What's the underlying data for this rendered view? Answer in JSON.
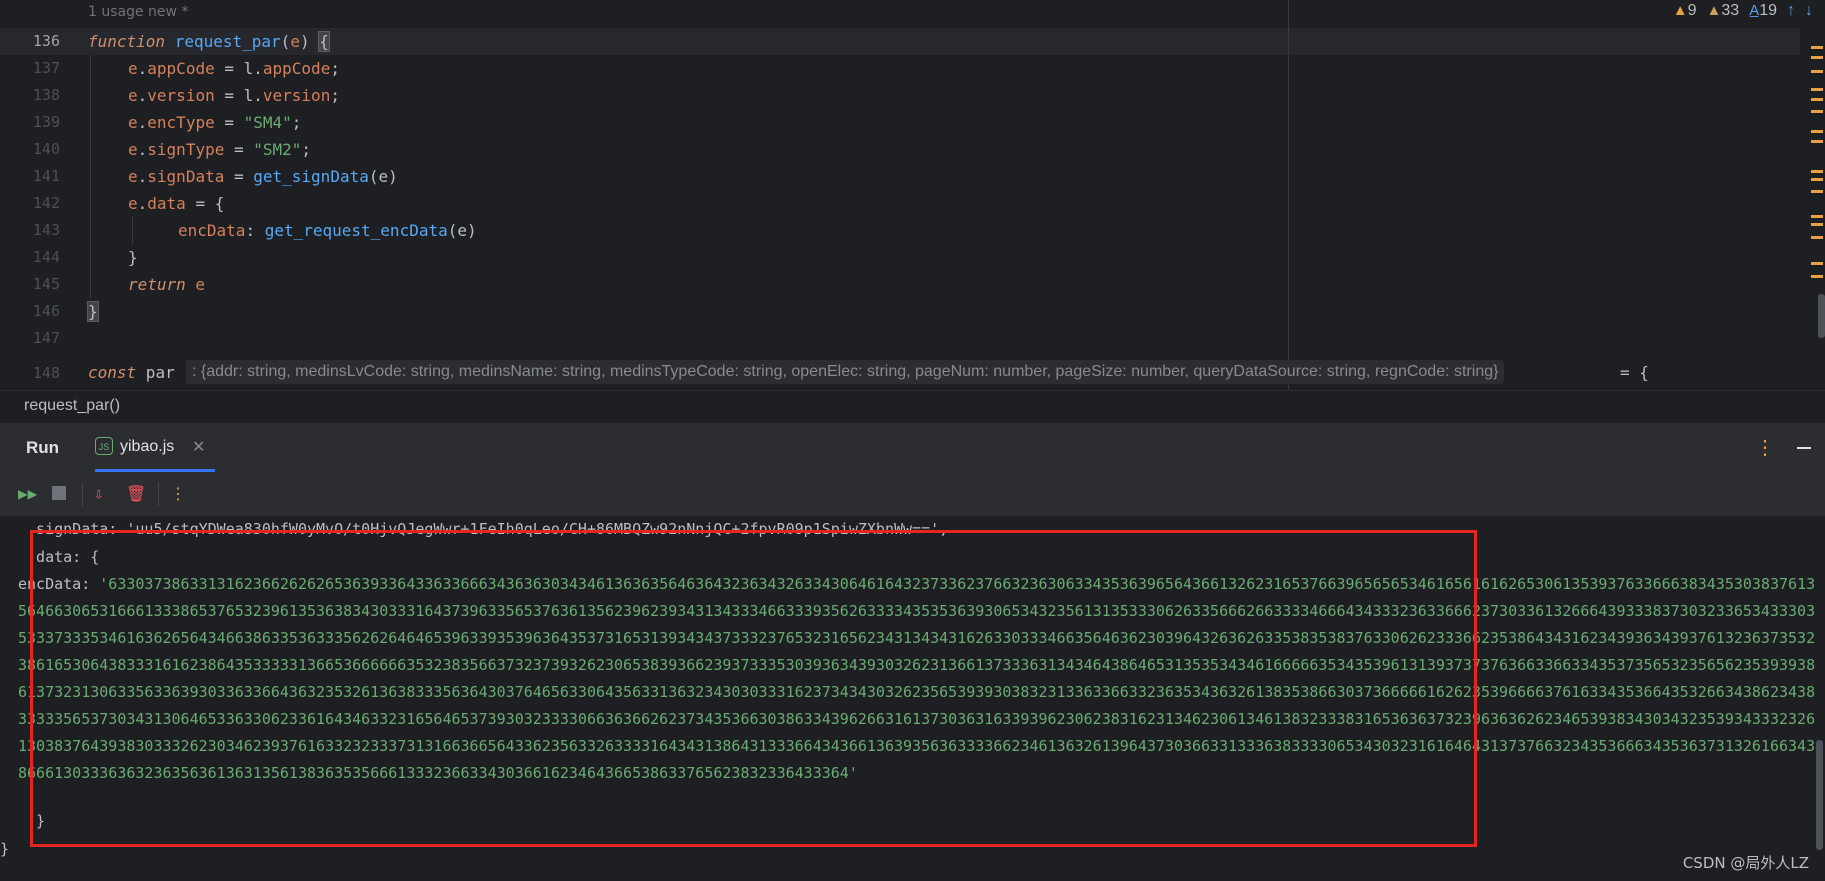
{
  "editor": {
    "usage_hint": "1 usage   new *",
    "line_numbers": [
      "136",
      "137",
      "138",
      "139",
      "140",
      "141",
      "142",
      "143",
      "144",
      "145",
      "146",
      "147",
      "148"
    ],
    "lines": {
      "l136_kw": "function",
      "l136_name": "request_par",
      "l136_open": "(",
      "l136_param": "e",
      "l136_close": ") ",
      "l136_brace": "{",
      "l137_obj": "e",
      "l137_prop": "appCode",
      "l137_eq": " = l.",
      "l137_rhs": "appCode",
      "l137_semi": ";",
      "l138_obj": "e",
      "l138_prop": "version",
      "l138_eq": " = l.",
      "l138_rhs": "version",
      "l138_semi": ";",
      "l139_obj": "e",
      "l139_prop": "encType",
      "l139_eq": " = ",
      "l139_str": "\"SM4\"",
      "l139_semi": ";",
      "l140_obj": "e",
      "l140_prop": "signType",
      "l140_eq": " = ",
      "l140_str": "\"SM2\"",
      "l140_semi": ";",
      "l141_obj": "e",
      "l141_prop": "signData",
      "l141_eq": " = ",
      "l141_fn": "get_signData",
      "l141_arg": "(e)",
      "l142_obj": "e",
      "l142_prop": "data",
      "l142_rest": " = {",
      "l143_key": "encData",
      "l143_colon": ": ",
      "l143_fn": "get_request_encData",
      "l143_arg": "(e)",
      "l144": "}",
      "l145_kw": "return",
      "l145_var": " e",
      "l146": "}",
      "l148_kw": "const",
      "l148_name": " par"
    },
    "inlay_hint": ": {addr: string, medinsLvCode: string, medinsName: string, medinsTypeCode: string, openElec: string, pageNum: number, pageSize: number, queryDataSource: string, regnCode: string}",
    "inlay_after": "= {",
    "inspections": {
      "warnings": "9",
      "weak_warnings": "33",
      "typos": "19"
    }
  },
  "breadcrumb": "request_par()",
  "run_panel": {
    "title": "Run",
    "tab_label": "yibao.js",
    "tab_icon": "JS"
  },
  "console": {
    "sign_line": "  signData: 'uu5/stqYDWea830hfW0yMvO/t0HjvQJegWwr+1FeIh0qLeo/CH+86MBQZw92nNnjQC+2fpvR09p1SpiwZXbnWw==',",
    "data_line": "  data: {",
    "enc_key": "    encData: ",
    "enc_value": "'63303738633131623662626265363933643363366634363630343461363635646364323634326334306461643237336237663236306334353639656436613262316537663965656534616561616265306135393763366638343530383761356466306531666133386537653239613536383430333164373963356537636135623962393431343334663339356263333435353639306534323561313533306263356662663333466643433323633666237303361326664393338373032336534333035333733353461636265643466386335363335626264646539633935396364353731653139343437333237653231656234313434316263303334663564636230396432636263353835383763306262333662353864343162343936343937613236373532386165306438333161623864353333313665366666635323835663732373932623065383936623937333530393634393032623136613733363134346438646531353534346166666353435396131393737376366336633435373565323565623539393861373231306335633639303363366436323532613638333563643037646563306435633136323430303331623734343032623565393930383231336336633236353436326138353866303736666616262353966663761633435366435326634386234383333356537303431306465336330623361643463323165646537393032333306636366262373435366303863343962663161373036316339396230623831623134623061346138323338316536363732396363626234653938343034323539343332326130383764393830333262303462393761633232333731316636656433623563326333316434313864313336643436613639356363333662346136326139643730366331333638333306534303231616464313737663234353666343536373132616634386661303336363236356361363135613836353566613332366334303661623464366538633765623832336433364'",
    "close_inner": "  }",
    "close_outer": "}"
  },
  "watermark": "CSDN @局外人LZ",
  "colors": {
    "background": "#1e1f22",
    "panel": "#2b2d30",
    "keyword": "#cf8e6d",
    "function": "#56a8f5",
    "string": "#6aab73",
    "property": "#c77dbb",
    "highlight_box": "#e5251f",
    "accent": "#3574f0"
  }
}
